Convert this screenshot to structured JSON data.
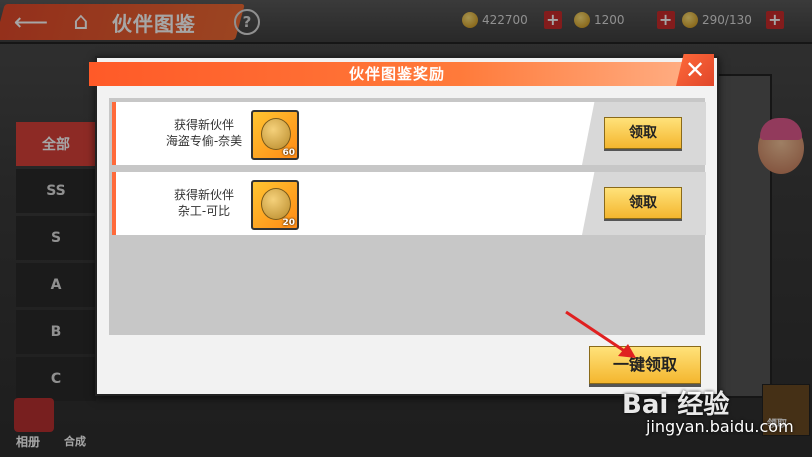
{
  "header": {
    "title": "伙伴图鉴",
    "help_label": "?"
  },
  "resources": [
    {
      "icon": "gold-coin-icon",
      "value": "422700"
    },
    {
      "icon": "fruit-icon",
      "value": "1200"
    },
    {
      "icon": "stamina-icon",
      "value": "290/130"
    }
  ],
  "side_tabs": [
    {
      "label": "全部",
      "active": true
    },
    {
      "label": "SS"
    },
    {
      "label": "S"
    },
    {
      "label": "A"
    },
    {
      "label": "B"
    },
    {
      "label": "C"
    }
  ],
  "bottom_left": {
    "album_label": "相册",
    "combine_label": "合成"
  },
  "right_side": {
    "claim_label": "领取"
  },
  "modal": {
    "title": "伙伴图鉴奖励",
    "rows": [
      {
        "line1": "获得新伙伴",
        "line2": "海盗专偷-奈美",
        "item_icon": "devil-fruit-icon",
        "count": "60",
        "button": "领取"
      },
      {
        "line1": "获得新伙伴",
        "line2": "杂工-可比",
        "item_icon": "devil-fruit-icon",
        "count": "20",
        "button": "领取"
      }
    ],
    "claim_all": "一键领取",
    "colors": {
      "accent": "#ff6a3a",
      "button": "#f4b62e"
    }
  },
  "watermark": {
    "logo": "Bai 经验",
    "url": "jingyan.baidu.com"
  }
}
